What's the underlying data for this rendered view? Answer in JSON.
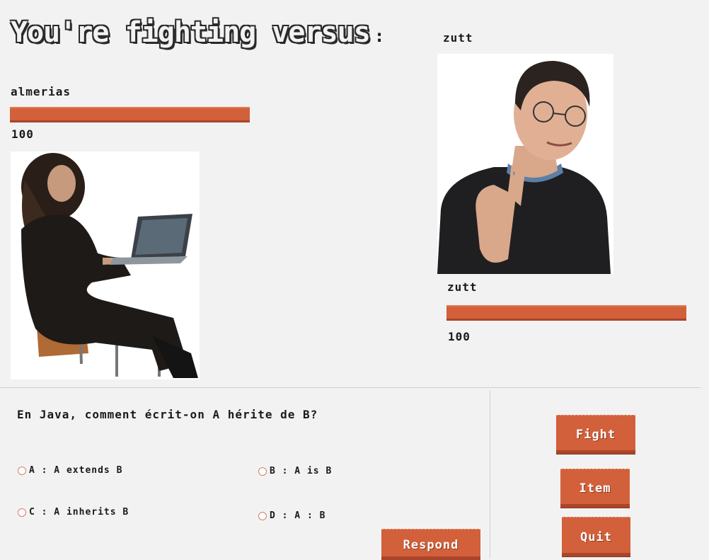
{
  "header": {
    "title": "You're fighting versus",
    "colon": ":",
    "opponent_name": "zutt"
  },
  "player": {
    "name": "almerias",
    "hp_value": "100",
    "hp_fraction": 1.0
  },
  "opponent": {
    "name": "zutt",
    "hp_value": "100",
    "hp_fraction": 1.0
  },
  "quiz": {
    "question": "En Java, comment écrit-on A hérite de B?",
    "options": [
      {
        "label": "A : A extends B"
      },
      {
        "label": "B : A is B"
      },
      {
        "label": "C : A inherits B"
      },
      {
        "label": "D : A : B"
      }
    ],
    "respond_label": "Respond"
  },
  "actions": {
    "fight_label": "Fight",
    "item_label": "Item",
    "quit_label": "Quit"
  },
  "colors": {
    "accent": "#d2603a",
    "background": "#f3f2f2"
  }
}
